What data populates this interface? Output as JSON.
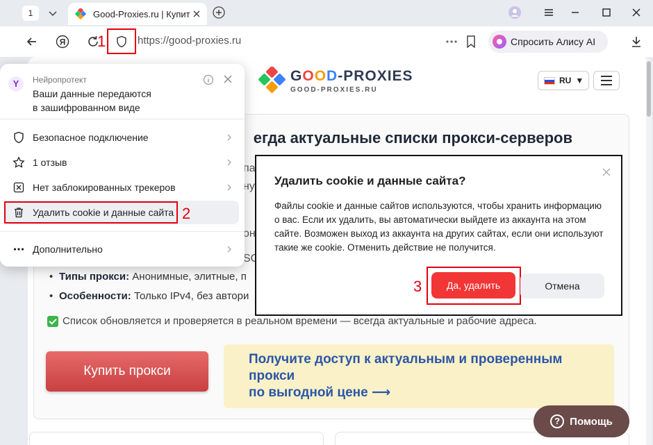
{
  "browser": {
    "tab_count": "1",
    "tab_title": "Good-Proxies.ru | Купить",
    "url": "https://good-proxies.ru",
    "alice_label": "Спросить Алису AI",
    "icons": [
      "chevron-down-icon",
      "favicon-icon",
      "close-icon",
      "plus-icon",
      "profile-icon",
      "menu-icon",
      "minimize-icon",
      "maximize-icon",
      "close-window-icon",
      "back-icon",
      "yandex-icon",
      "reload-icon",
      "shield-icon",
      "more-icon",
      "bookmark-icon",
      "download-icon"
    ]
  },
  "annotations": {
    "n1": "1",
    "n2": "2",
    "n3": "3",
    "color": "#e0000e"
  },
  "site": {
    "logo_good": [
      "G",
      "O",
      "O",
      "D"
    ],
    "logo_rest": "-PROXIES",
    "logo_sub": "GOOD-PROXIES.RU",
    "lang": "RU",
    "title_visible": "егда актуальные списки прокси-серверов",
    "fragments": [
      "па",
      "ну",
      "он",
      "SO"
    ],
    "bullet_types_label": "Типы прокси:",
    "bullet_types_text": " Анонимные, элитные, п",
    "bullet_features_label": "Особенности:",
    "bullet_features_text": " Только IPv4, без автори",
    "note": "Список обновляется и проверяется в реальном времени — всегда актуальные и рабочие адреса.",
    "buy_button": "Купить прокси",
    "promo_line1": "Получите доступ к актуальным и проверенным",
    "promo_line2": "прокси",
    "promo_line3": "по выгодной цене  ⟶",
    "help_button": "Помощь",
    "colors": {
      "buy": "#d85454",
      "promo_bg": "#fbf1c8",
      "promo_text": "#2a56a8",
      "help_bg": "#6b4a4a"
    }
  },
  "security_popup": {
    "brand": "Нейропротект",
    "heading_line1": "Ваши данные передаются",
    "heading_line2": "в зашифрованном виде",
    "items": [
      {
        "label": "Безопасное подключение",
        "icon": "shield-icon"
      },
      {
        "label": "1 отзыв",
        "icon": "star-icon"
      },
      {
        "label": "Нет заблокированных трекеров",
        "icon": "blocked-icon"
      },
      {
        "label": "Удалить cookie и данные сайта",
        "icon": "trash-icon"
      },
      {
        "label": "Дополнительно",
        "icon": "more-icon"
      }
    ]
  },
  "dialog": {
    "title": "Удалить cookie и данные сайта?",
    "body": "Файлы cookie и данные сайтов используются, чтобы хранить информацию о вас. Если их удалить, вы автоматически выйдете из аккаунта на этом сайте. Возможен выход из аккаунта на других сайтах, если они используют такие же cookie. Отменить действие не получится.",
    "confirm": "Да, удалить",
    "cancel": "Отмена",
    "confirm_color": "#f23535"
  }
}
